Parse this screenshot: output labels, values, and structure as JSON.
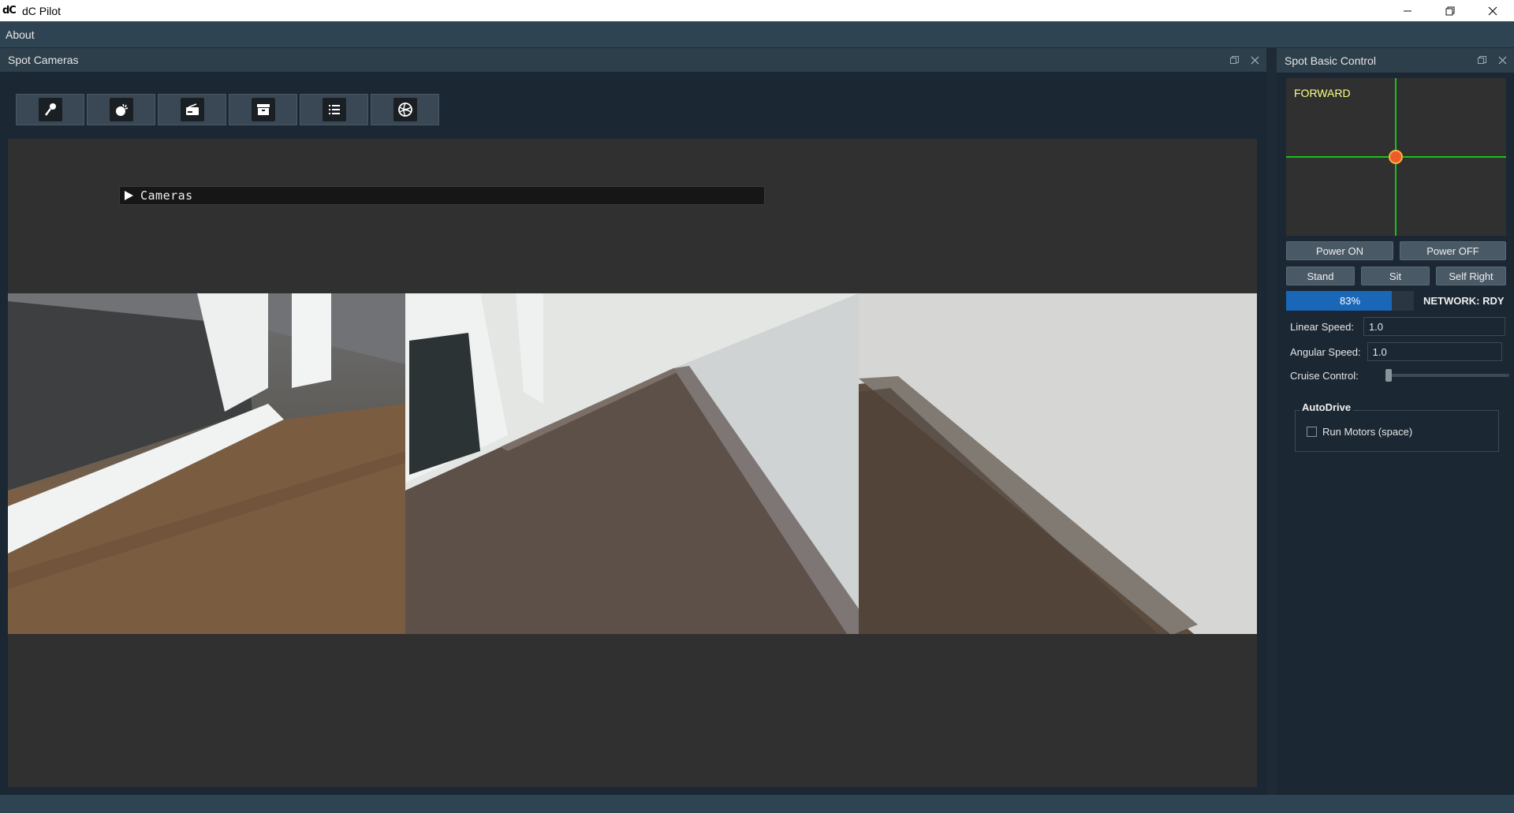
{
  "window": {
    "logo_text": "dC",
    "title": "dC Pilot",
    "controls": {
      "minimize": "—",
      "restore": "⧉",
      "close": "✕"
    }
  },
  "menu": {
    "items": [
      {
        "label": "About"
      }
    ]
  },
  "cameras_dock": {
    "title": "Spot Cameras",
    "header_icons": [
      "float-icon",
      "close-icon"
    ],
    "toolbar_icons": [
      "microphone-icon",
      "light-icon",
      "radio-icon",
      "archive-icon",
      "list-icon",
      "globe-icon"
    ],
    "collapsible": {
      "label": "Cameras",
      "expanded": false
    },
    "feeds": [
      "camera-feed-left",
      "camera-feed-center",
      "camera-feed-right"
    ]
  },
  "control_dock": {
    "title": "Spot Basic Control",
    "header_icons": [
      "float-icon",
      "close-icon"
    ],
    "joystick": {
      "label": "FORWARD",
      "line_color": "#19c119",
      "knob_color": "#f05a2a"
    },
    "power_on": "Power ON",
    "power_off": "Power OFF",
    "stand": "Stand",
    "sit": "Sit",
    "self_right": "Self Right",
    "battery": {
      "value": 0.83,
      "text": "83%",
      "color": "#1a67b8"
    },
    "network_status": "NETWORK: RDY",
    "linear_speed": {
      "label": "Linear Speed:",
      "value": "1.0"
    },
    "angular_speed": {
      "label": "Angular Speed:",
      "value": "1.0"
    },
    "cruise_control": {
      "label": "Cruise Control:",
      "value": 0
    },
    "autodrive": {
      "title": "AutoDrive",
      "run_motors_label": "Run Motors (space)",
      "run_motors_checked": false
    }
  }
}
